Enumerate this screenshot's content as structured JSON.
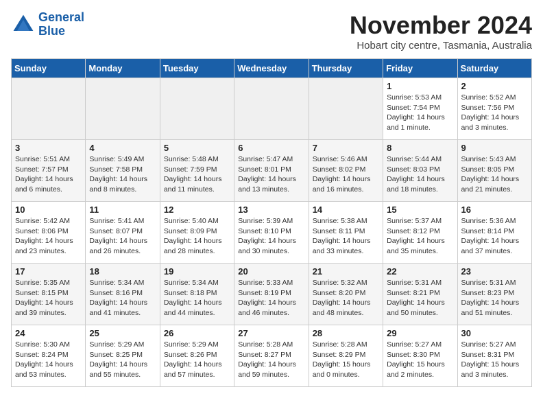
{
  "header": {
    "logo_line1": "General",
    "logo_line2": "Blue",
    "month": "November 2024",
    "location": "Hobart city centre, Tasmania, Australia"
  },
  "weekdays": [
    "Sunday",
    "Monday",
    "Tuesday",
    "Wednesday",
    "Thursday",
    "Friday",
    "Saturday"
  ],
  "weeks": [
    [
      {
        "day": "",
        "info": ""
      },
      {
        "day": "",
        "info": ""
      },
      {
        "day": "",
        "info": ""
      },
      {
        "day": "",
        "info": ""
      },
      {
        "day": "",
        "info": ""
      },
      {
        "day": "1",
        "info": "Sunrise: 5:53 AM\nSunset: 7:54 PM\nDaylight: 14 hours\nand 1 minute."
      },
      {
        "day": "2",
        "info": "Sunrise: 5:52 AM\nSunset: 7:56 PM\nDaylight: 14 hours\nand 3 minutes."
      }
    ],
    [
      {
        "day": "3",
        "info": "Sunrise: 5:51 AM\nSunset: 7:57 PM\nDaylight: 14 hours\nand 6 minutes."
      },
      {
        "day": "4",
        "info": "Sunrise: 5:49 AM\nSunset: 7:58 PM\nDaylight: 14 hours\nand 8 minutes."
      },
      {
        "day": "5",
        "info": "Sunrise: 5:48 AM\nSunset: 7:59 PM\nDaylight: 14 hours\nand 11 minutes."
      },
      {
        "day": "6",
        "info": "Sunrise: 5:47 AM\nSunset: 8:01 PM\nDaylight: 14 hours\nand 13 minutes."
      },
      {
        "day": "7",
        "info": "Sunrise: 5:46 AM\nSunset: 8:02 PM\nDaylight: 14 hours\nand 16 minutes."
      },
      {
        "day": "8",
        "info": "Sunrise: 5:44 AM\nSunset: 8:03 PM\nDaylight: 14 hours\nand 18 minutes."
      },
      {
        "day": "9",
        "info": "Sunrise: 5:43 AM\nSunset: 8:05 PM\nDaylight: 14 hours\nand 21 minutes."
      }
    ],
    [
      {
        "day": "10",
        "info": "Sunrise: 5:42 AM\nSunset: 8:06 PM\nDaylight: 14 hours\nand 23 minutes."
      },
      {
        "day": "11",
        "info": "Sunrise: 5:41 AM\nSunset: 8:07 PM\nDaylight: 14 hours\nand 26 minutes."
      },
      {
        "day": "12",
        "info": "Sunrise: 5:40 AM\nSunset: 8:09 PM\nDaylight: 14 hours\nand 28 minutes."
      },
      {
        "day": "13",
        "info": "Sunrise: 5:39 AM\nSunset: 8:10 PM\nDaylight: 14 hours\nand 30 minutes."
      },
      {
        "day": "14",
        "info": "Sunrise: 5:38 AM\nSunset: 8:11 PM\nDaylight: 14 hours\nand 33 minutes."
      },
      {
        "day": "15",
        "info": "Sunrise: 5:37 AM\nSunset: 8:12 PM\nDaylight: 14 hours\nand 35 minutes."
      },
      {
        "day": "16",
        "info": "Sunrise: 5:36 AM\nSunset: 8:14 PM\nDaylight: 14 hours\nand 37 minutes."
      }
    ],
    [
      {
        "day": "17",
        "info": "Sunrise: 5:35 AM\nSunset: 8:15 PM\nDaylight: 14 hours\nand 39 minutes."
      },
      {
        "day": "18",
        "info": "Sunrise: 5:34 AM\nSunset: 8:16 PM\nDaylight: 14 hours\nand 41 minutes."
      },
      {
        "day": "19",
        "info": "Sunrise: 5:34 AM\nSunset: 8:18 PM\nDaylight: 14 hours\nand 44 minutes."
      },
      {
        "day": "20",
        "info": "Sunrise: 5:33 AM\nSunset: 8:19 PM\nDaylight: 14 hours\nand 46 minutes."
      },
      {
        "day": "21",
        "info": "Sunrise: 5:32 AM\nSunset: 8:20 PM\nDaylight: 14 hours\nand 48 minutes."
      },
      {
        "day": "22",
        "info": "Sunrise: 5:31 AM\nSunset: 8:21 PM\nDaylight: 14 hours\nand 50 minutes."
      },
      {
        "day": "23",
        "info": "Sunrise: 5:31 AM\nSunset: 8:23 PM\nDaylight: 14 hours\nand 51 minutes."
      }
    ],
    [
      {
        "day": "24",
        "info": "Sunrise: 5:30 AM\nSunset: 8:24 PM\nDaylight: 14 hours\nand 53 minutes."
      },
      {
        "day": "25",
        "info": "Sunrise: 5:29 AM\nSunset: 8:25 PM\nDaylight: 14 hours\nand 55 minutes."
      },
      {
        "day": "26",
        "info": "Sunrise: 5:29 AM\nSunset: 8:26 PM\nDaylight: 14 hours\nand 57 minutes."
      },
      {
        "day": "27",
        "info": "Sunrise: 5:28 AM\nSunset: 8:27 PM\nDaylight: 14 hours\nand 59 minutes."
      },
      {
        "day": "28",
        "info": "Sunrise: 5:28 AM\nSunset: 8:29 PM\nDaylight: 15 hours\nand 0 minutes."
      },
      {
        "day": "29",
        "info": "Sunrise: 5:27 AM\nSunset: 8:30 PM\nDaylight: 15 hours\nand 2 minutes."
      },
      {
        "day": "30",
        "info": "Sunrise: 5:27 AM\nSunset: 8:31 PM\nDaylight: 15 hours\nand 3 minutes."
      }
    ]
  ]
}
